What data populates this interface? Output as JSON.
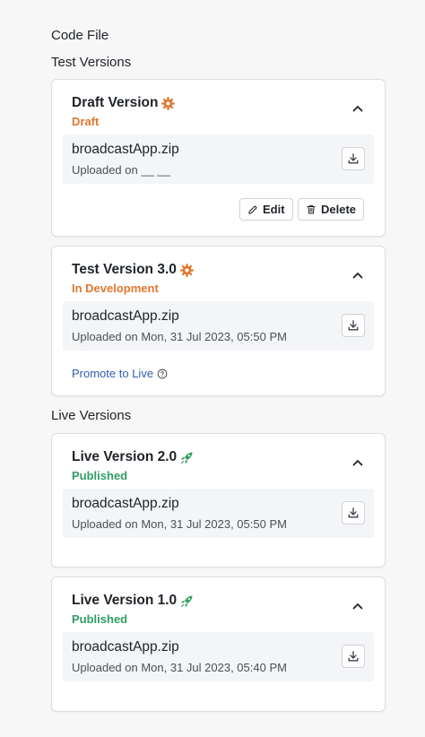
{
  "colors": {
    "draft": "#e0782f",
    "in_development": "#e0782f",
    "published": "#2f9e63",
    "link": "#2f5fb3"
  },
  "header": {
    "code_file": "Code File",
    "test_versions": "Test Versions",
    "live_versions": "Live Versions"
  },
  "test_versions": [
    {
      "title": "Draft Version",
      "title_icon": "gear-icon",
      "status": "Draft",
      "file_name": "broadcastApp.zip",
      "uploaded": "Uploaded on __ __",
      "actions": {
        "edit": "Edit",
        "delete": "Delete"
      }
    },
    {
      "title": "Test Version 3.0",
      "title_icon": "gear-icon",
      "status": "In Development",
      "file_name": "broadcastApp.zip",
      "uploaded": "Uploaded on Mon, 31 Jul 2023, 05:50 PM",
      "promote": "Promote to Live"
    }
  ],
  "live_versions": [
    {
      "title": "Live Version 2.0",
      "title_icon": "rocket-icon",
      "status": "Published",
      "file_name": "broadcastApp.zip",
      "uploaded": "Uploaded on Mon, 31 Jul 2023, 05:50 PM"
    },
    {
      "title": "Live Version 1.0",
      "title_icon": "rocket-icon",
      "status": "Published",
      "file_name": "broadcastApp.zip",
      "uploaded": "Uploaded on Mon, 31 Jul 2023, 05:40 PM"
    }
  ]
}
